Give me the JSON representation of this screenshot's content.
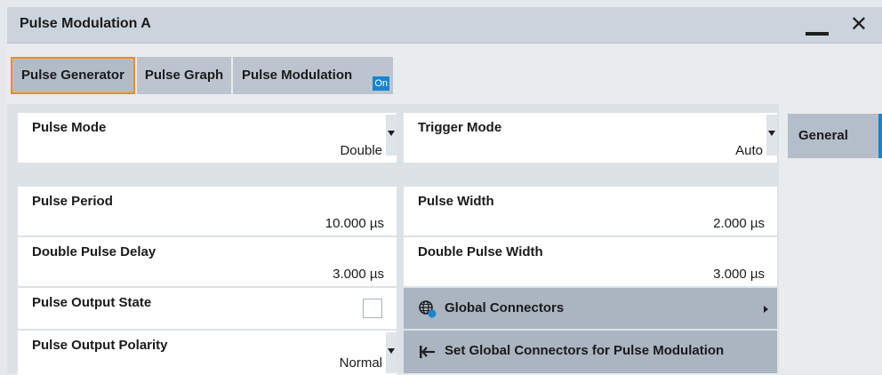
{
  "window": {
    "title": "Pulse Modulation A"
  },
  "tabs": [
    {
      "label": "Pulse Generator"
    },
    {
      "label": "Pulse Graph"
    },
    {
      "label": "Pulse Modulation",
      "badge": "On"
    }
  ],
  "settings": {
    "pulse_mode": {
      "label": "Pulse Mode",
      "value": "Double"
    },
    "trigger_mode": {
      "label": "Trigger Mode",
      "value": "Auto"
    },
    "pulse_period": {
      "label": "Pulse Period",
      "value": "10.000 µs"
    },
    "pulse_width": {
      "label": "Pulse Width",
      "value": "2.000 µs"
    },
    "double_pulse_delay": {
      "label": "Double Pulse Delay",
      "value": "3.000 µs"
    },
    "double_pulse_width": {
      "label": "Double Pulse Width",
      "value": "3.000 µs"
    },
    "pulse_output_state": {
      "label": "Pulse Output State",
      "checked": false
    },
    "pulse_output_polarity": {
      "label": "Pulse Output Polarity",
      "value": "Normal"
    }
  },
  "buttons": {
    "global_connectors": "Global Connectors",
    "set_global_connectors": "Set Global Connectors for Pulse Modulation"
  },
  "side_nav": {
    "general": "General"
  },
  "colors": {
    "accent": "#1785cf",
    "active_tab_border": "#f08c1e"
  }
}
